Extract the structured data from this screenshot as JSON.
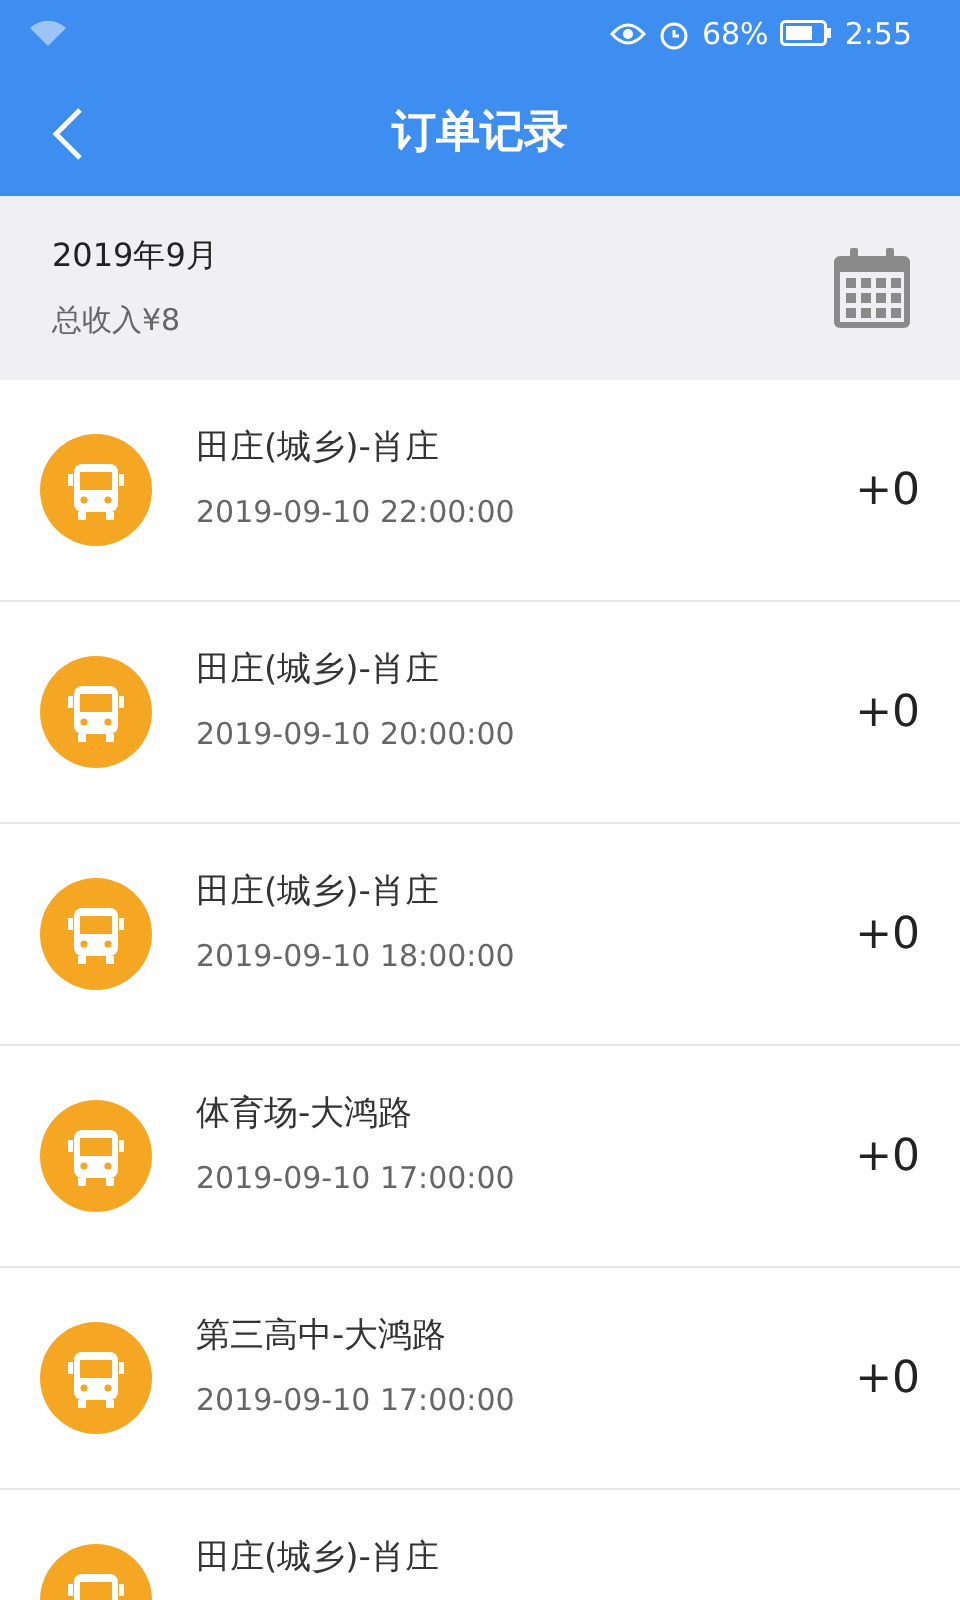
{
  "status_bar": {
    "battery_text": "68%",
    "time": "2:55"
  },
  "header": {
    "title": "订单记录"
  },
  "summary": {
    "month": "2019年9月",
    "income": "总收入¥8"
  },
  "orders": [
    {
      "route": "田庄(城乡)-肖庄",
      "time": "2019-09-10 22:00:00",
      "amount": "+0"
    },
    {
      "route": "田庄(城乡)-肖庄",
      "time": "2019-09-10 20:00:00",
      "amount": "+0"
    },
    {
      "route": "田庄(城乡)-肖庄",
      "time": "2019-09-10 18:00:00",
      "amount": "+0"
    },
    {
      "route": "体育场-大鸿路",
      "time": "2019-09-10 17:00:00",
      "amount": "+0"
    },
    {
      "route": "第三高中-大鸿路",
      "time": "2019-09-10 17:00:00",
      "amount": "+0"
    },
    {
      "route": "田庄(城乡)-肖庄"
    }
  ]
}
